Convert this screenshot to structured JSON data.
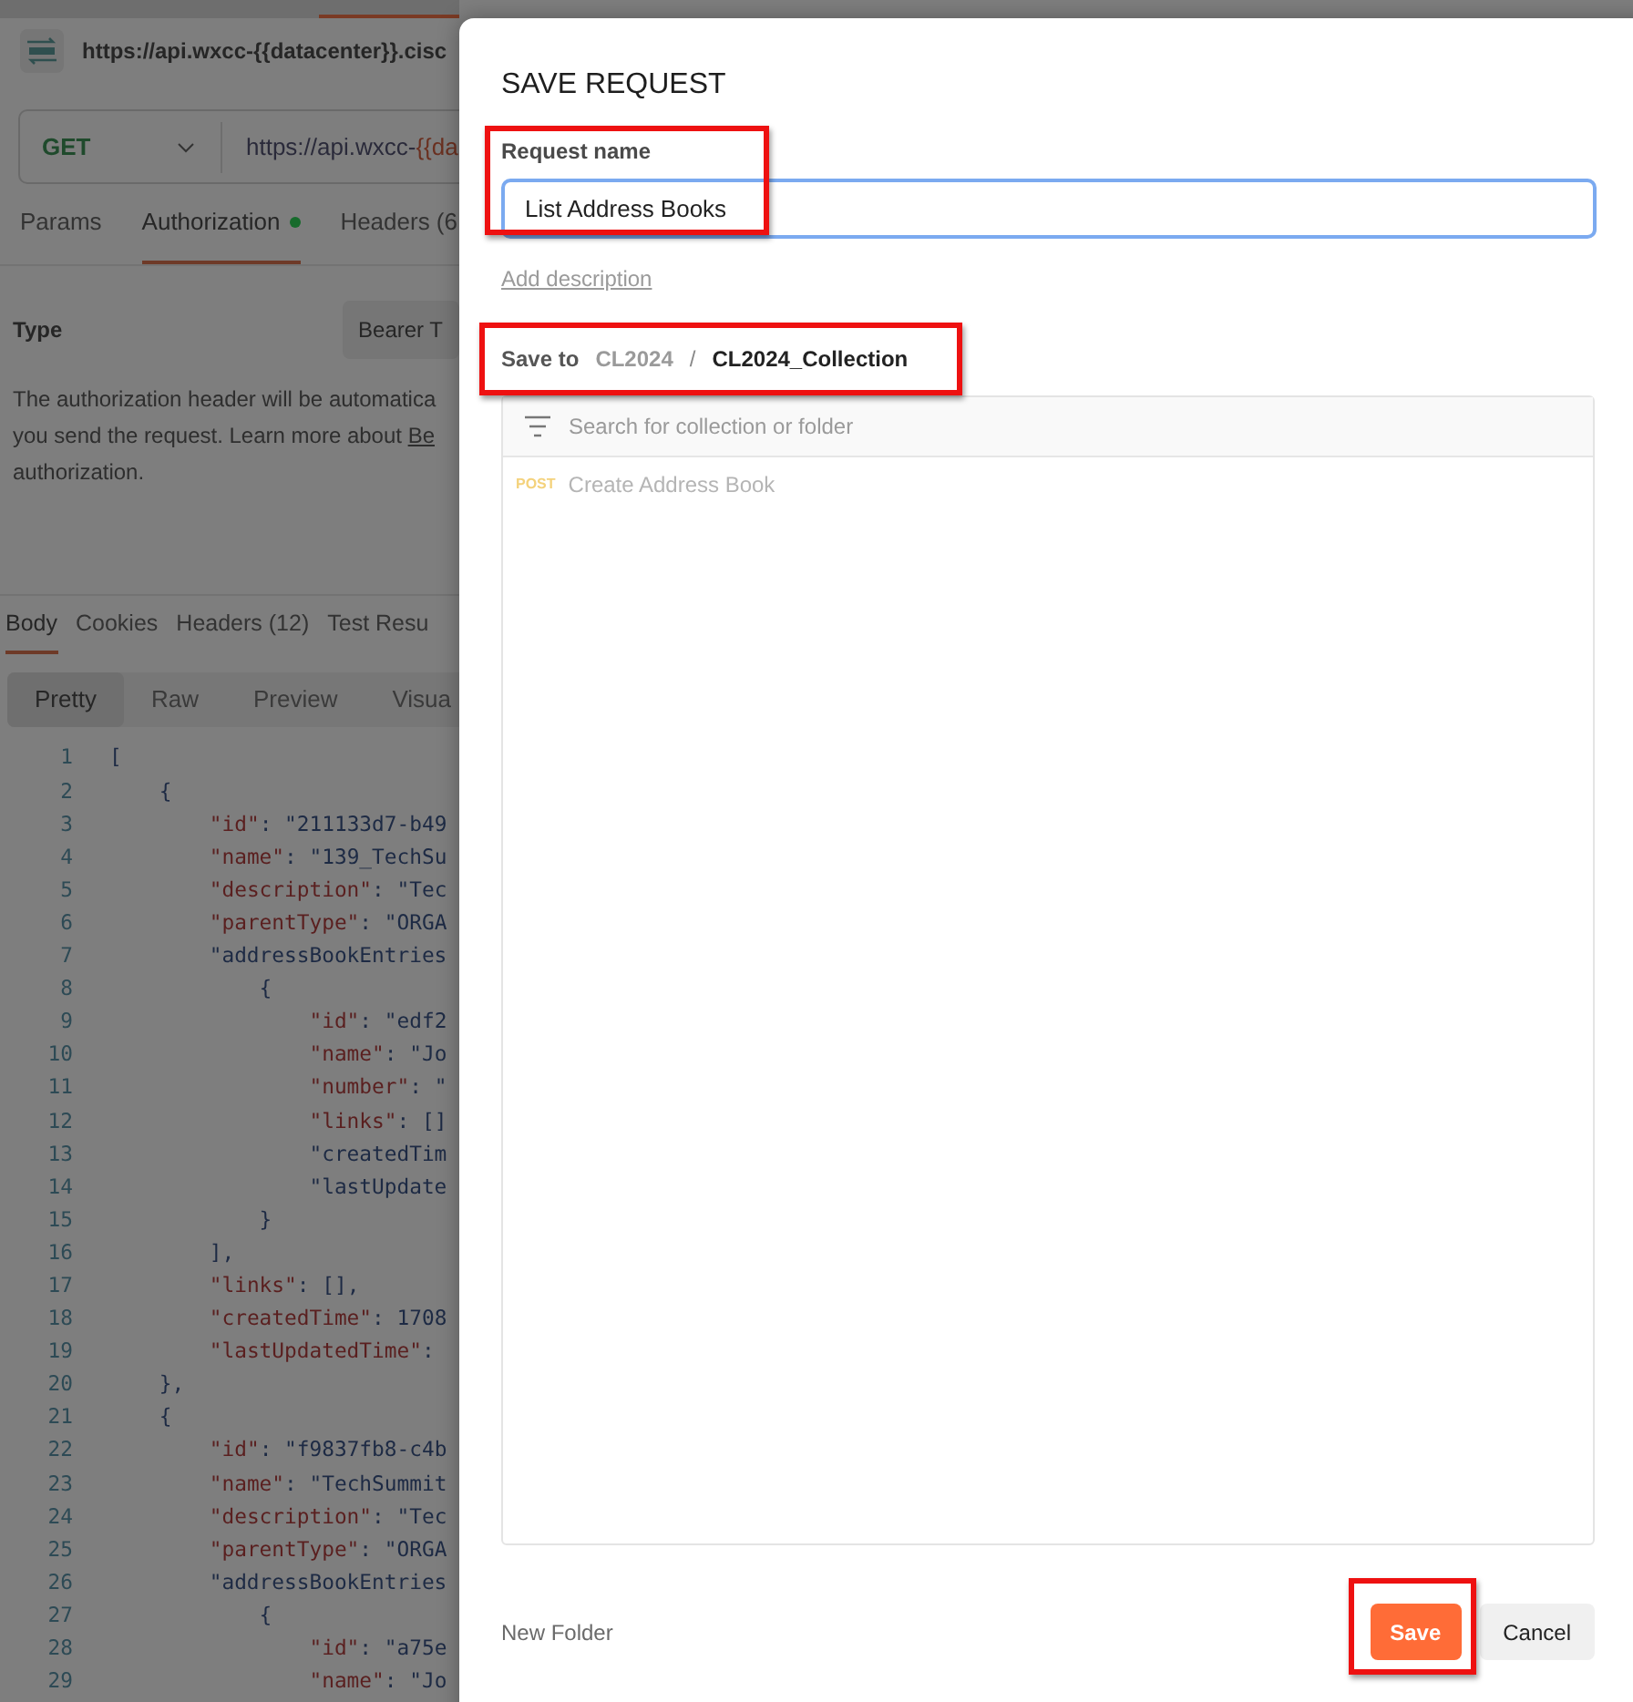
{
  "request": {
    "title": "https://api.wxcc-{{datacenter}}.cisc",
    "method": "GET",
    "url_prefix": "https://api.wxcc-",
    "url_variable": "{{da"
  },
  "request_tabs": [
    {
      "label": "Params",
      "selected": false,
      "dot": false
    },
    {
      "label": "Authorization",
      "selected": true,
      "dot": true
    },
    {
      "label": "Headers (6",
      "selected": false,
      "dot": false
    }
  ],
  "auth": {
    "type_label": "Type",
    "type_value": "Bearer T",
    "help_lines": [
      "The authorization header will be automatica",
      "you send the request. Learn more about ",
      "authorization."
    ],
    "help_link": "Be"
  },
  "response_tabs": [
    {
      "label": "Body",
      "selected": true
    },
    {
      "label": "Cookies",
      "selected": false
    },
    {
      "label": "Headers (12)",
      "selected": false
    },
    {
      "label": "Test Resu",
      "selected": false
    }
  ],
  "format_tabs": [
    {
      "label": "Pretty",
      "selected": true
    },
    {
      "label": "Raw",
      "selected": false
    },
    {
      "label": "Preview",
      "selected": false
    },
    {
      "label": "Visua",
      "selected": false
    }
  ],
  "code_lines": [
    {
      "number": "1",
      "text": "["
    },
    {
      "number": "2",
      "text": "    {"
    },
    {
      "number": "3",
      "text": "        \"id\": \"211133d7-b49"
    },
    {
      "number": "4",
      "text": "        \"name\": \"139_TechSu"
    },
    {
      "number": "5",
      "text": "        \"description\": \"Tec"
    },
    {
      "number": "6",
      "text": "        \"parentType\": \"ORGA"
    },
    {
      "number": "7",
      "text": "        \"addressBookEntries"
    },
    {
      "number": "8",
      "text": "            {"
    },
    {
      "number": "9",
      "text": "                \"id\": \"edf2"
    },
    {
      "number": "10",
      "text": "                \"name\": \"Jo"
    },
    {
      "number": "11",
      "text": "                \"number\": \""
    },
    {
      "number": "12",
      "text": "                \"links\": []"
    },
    {
      "number": "13",
      "text": "                \"createdTim"
    },
    {
      "number": "14",
      "text": "                \"lastUpdate"
    },
    {
      "number": "15",
      "text": "            }"
    },
    {
      "number": "16",
      "text": "        ],"
    },
    {
      "number": "17",
      "text": "        \"links\": [],"
    },
    {
      "number": "18",
      "text": "        \"createdTime\": 1708"
    },
    {
      "number": "19",
      "text": "        \"lastUpdatedTime\":"
    },
    {
      "number": "20",
      "text": "    },"
    },
    {
      "number": "21",
      "text": "    {"
    },
    {
      "number": "22",
      "text": "        \"id\": \"f9837fb8-c4b"
    },
    {
      "number": "23",
      "text": "        \"name\": \"TechSummit"
    },
    {
      "number": "24",
      "text": "        \"description\": \"Tec"
    },
    {
      "number": "25",
      "text": "        \"parentType\": \"ORGA"
    },
    {
      "number": "26",
      "text": "        \"addressBookEntries"
    },
    {
      "number": "27",
      "text": "            {"
    },
    {
      "number": "28",
      "text": "                \"id\": \"a75e"
    },
    {
      "number": "29",
      "text": "                \"name\": \"Jo"
    }
  ],
  "dialog": {
    "title": "SAVE REQUEST",
    "name_label": "Request name",
    "name_value": "List Address Books",
    "add_description": "Add description",
    "save_to_label": "Save to",
    "path": [
      {
        "label": "CL2024",
        "current": false
      },
      {
        "label": "CL2024_Collection",
        "current": true
      }
    ],
    "path_separator": "/",
    "search_placeholder": "Search for collection or folder",
    "items": [
      {
        "method": "POST",
        "name": "Create Address Book"
      }
    ],
    "new_folder": "New Folder",
    "save_button": "Save",
    "cancel_button": "Cancel"
  }
}
